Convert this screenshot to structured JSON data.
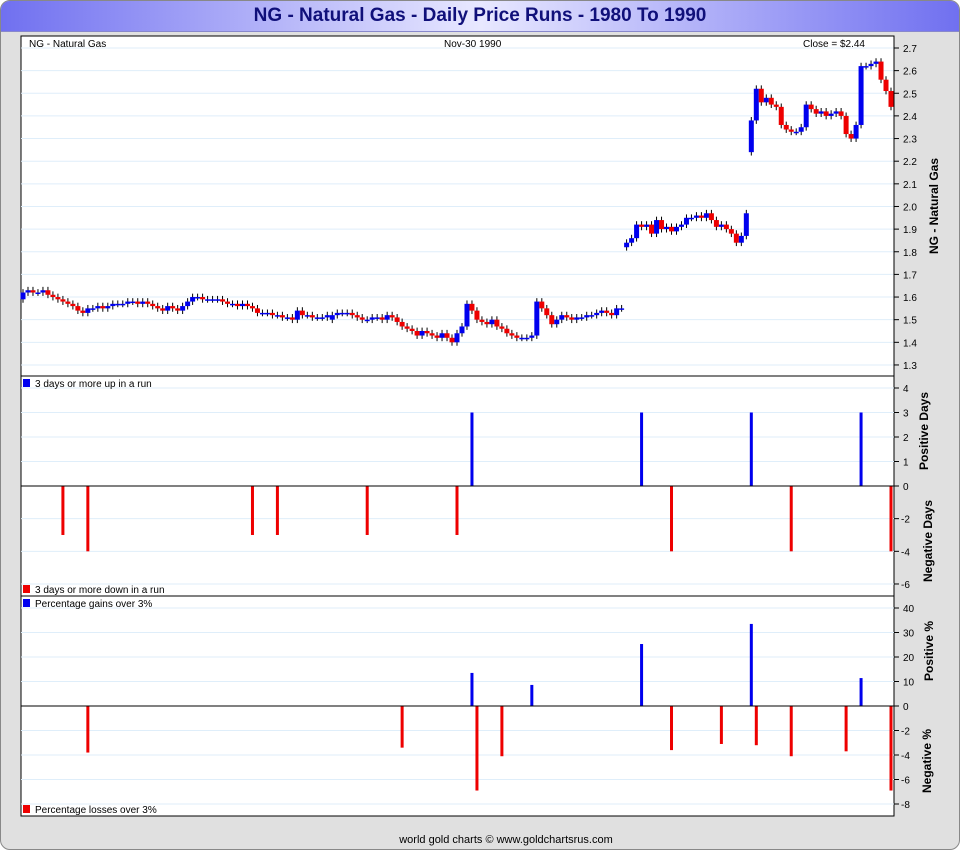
{
  "title": "NG  -  Natural Gas - Daily Price Runs - 1980 To 1990",
  "header": {
    "symbol": "NG  -  Natural Gas",
    "date": "Nov-30  1990",
    "close": "Close = $2.44"
  },
  "footer": "world gold charts © www.goldchartsrus.com",
  "colors": {
    "up": "#0000ee",
    "down": "#ee0000",
    "grid": "#dfeefa"
  },
  "chart_data": [
    {
      "type": "candlestick",
      "title": "NG - Natural Gas",
      "ylabel": "NG  -  Natural Gas",
      "ylim": [
        1.25,
        2.72
      ],
      "yticks": [
        "2.7",
        "2.6",
        "2.5",
        "2.4",
        "2.3",
        "2.2",
        "2.1",
        "2.0",
        "1.9",
        "1.8",
        "1.7",
        "1.6",
        "1.5",
        "1.4",
        "1.3"
      ],
      "first_open": 1.59,
      "closes": [
        1.62,
        1.63,
        1.62,
        1.62,
        1.63,
        1.61,
        1.6,
        1.59,
        1.58,
        1.57,
        1.56,
        1.54,
        1.53,
        1.55,
        1.55,
        1.56,
        1.55,
        1.56,
        1.57,
        1.57,
        1.57,
        1.58,
        1.58,
        1.57,
        1.58,
        1.57,
        1.56,
        1.55,
        1.54,
        1.56,
        1.55,
        1.54,
        1.56,
        1.58,
        1.6,
        1.6,
        1.59,
        1.59,
        1.59,
        1.59,
        1.58,
        1.57,
        1.57,
        1.56,
        1.57,
        1.56,
        1.55,
        1.53,
        1.53,
        1.53,
        1.52,
        1.52,
        1.51,
        1.51,
        1.5,
        1.54,
        1.52,
        1.52,
        1.51,
        1.51,
        1.51,
        1.52,
        1.52,
        1.53,
        1.53,
        1.53,
        1.52,
        1.51,
        1.5,
        1.5,
        1.51,
        1.51,
        1.5,
        1.52,
        1.51,
        1.49,
        1.47,
        1.46,
        1.45,
        1.43,
        1.45,
        1.44,
        1.43,
        1.42,
        1.44,
        1.42,
        1.4,
        1.44,
        1.47,
        1.57,
        1.54,
        1.5,
        1.49,
        1.48,
        1.5,
        1.47,
        1.46,
        1.44,
        1.43,
        1.42,
        1.42,
        1.42,
        1.43,
        1.58,
        1.55,
        1.52,
        1.48,
        1.5,
        1.52,
        1.51,
        1.5,
        1.51,
        1.51,
        1.52,
        1.52,
        1.53,
        1.54,
        1.53,
        1.52,
        1.55,
        1.55,
        1.84,
        1.86,
        1.92,
        1.91,
        1.92,
        1.88,
        1.94,
        1.9,
        1.91,
        1.89,
        1.91,
        1.92,
        1.95,
        1.95,
        1.96,
        1.95,
        1.97,
        1.94,
        1.91,
        1.92,
        1.9,
        1.88,
        1.84,
        1.87,
        1.97,
        2.38,
        2.52,
        2.46,
        2.48,
        2.45,
        2.44,
        2.36,
        2.34,
        2.33,
        2.33,
        2.35,
        2.45,
        2.43,
        2.41,
        2.42,
        2.4,
        2.41,
        2.42,
        2.4,
        2.32,
        2.3,
        2.36,
        2.62,
        2.62,
        2.63,
        2.64,
        2.56,
        2.51,
        2.44
      ],
      "gap_starts": [
        62,
        121,
        146
      ]
    },
    {
      "type": "bar",
      "title": "Daily Price Runs",
      "legend": [
        "3 days or more up in a run",
        "3 days or more down in a run"
      ],
      "ylabel_pos": "Positive Days",
      "ylabel_neg": "Negative Days",
      "yticks_pos": [
        "4",
        "3",
        "2",
        "1",
        "0"
      ],
      "yticks_neg": [
        "-2",
        "-4",
        "-6"
      ],
      "x": [
        8,
        13,
        46,
        51,
        69,
        87,
        90,
        124,
        130,
        146,
        154,
        168,
        174
      ],
      "values": [
        -3,
        -4,
        -3,
        -3,
        -3,
        -3,
        3,
        3,
        -4,
        3,
        -4,
        3,
        -4
      ]
    },
    {
      "type": "bar",
      "title": "Percentage moves",
      "legend": [
        "Percentage gains over 3%",
        "Percentage losses over 3%"
      ],
      "ylabel_pos": "Positive %",
      "ylabel_neg": "Negative %",
      "yticks_pos": [
        "40",
        "30",
        "20",
        "10",
        "0"
      ],
      "yticks_neg": [
        "-2",
        "-4",
        "-6",
        "-8"
      ],
      "x": [
        13,
        76,
        90,
        91,
        96,
        102,
        124,
        130,
        140,
        146,
        147,
        154,
        165,
        168,
        174
      ],
      "values": [
        -3.8,
        -3.4,
        13.5,
        -6.9,
        -4.1,
        8.6,
        25.3,
        -3.6,
        -3.1,
        33.5,
        -3.2,
        -4.1,
        -3.7,
        11.4,
        -6.9
      ]
    }
  ]
}
